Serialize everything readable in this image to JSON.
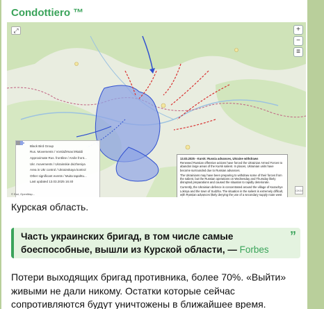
{
  "channel": {
    "name": "Condottiero ™"
  },
  "map": {
    "zoom_in": "+",
    "zoom_out": "−",
    "layers": "≡",
    "legend": [
      {
        "label": "Black Bird Group",
        "color": "#444444"
      },
      {
        "label": "Rus. Movements / Vorslažēnas lēkaldi",
        "color": "#d83030"
      },
      {
        "label": "Approximate Rus. frontline / Arvile front...",
        "color": "#3050d0"
      },
      {
        "label": "Ukr. movements / Ukrainskie dvizheniya",
        "color": "#3050d0"
      },
      {
        "label": "Area in Ukr control / Ukrainskaya kontrol",
        "color": "#8fa4e6"
      },
      {
        "label": "Other significant events / Muita tapahtu...",
        "color": "#777777"
      },
      {
        "label": "Last updated 13.03.2025 16:40",
        "color": "#999999"
      }
    ],
    "infobox": {
      "title": "13.03.2025 - Kursk: Russia advances, Ukraine withdraws",
      "p1": "Renewed Russian offensive actions have forced the Ukrainian Armed Forces to abandon large areas of the Kursk salient. In places, Ukrainian units have become surrounded due to Russian advances.",
      "p2": "The Ukrainians may have been preparing to withdraw some of their forces from the salient, but the Russian operations on Wednesday and Thursday likely disrupted preparations and caused the situation to rapidly deteriorate.",
      "p3": "Currently, the Ukrainian defence is concentrated around the village of Kazachye Loknya and the town of Sudzha. The situation in the salient is extremely difficult, with Russian advances likely denying the use of a secondary supply route west of Kurilovka, and the Main Supply Route from Sumy to Sudzha under constant drone observation. Ground conditions limit off-road vehicle movement."
    },
    "attribution": "© Esri, OpenMap...",
    "corner_badge": "CKGI"
  },
  "post": {
    "region_label": "Курская область.",
    "quote_text": "Часть украинских бригад, в том числе самые боеспособные, вышли из Курской области, —",
    "quote_source": "Forbes",
    "quote_mark": "”",
    "body": "Потери выходящих бригад противника, более 70%. «Выйти» живыми не дали никому. Остатки которые сейчас сопротивляются будут уничтожены в ближайшее время."
  }
}
